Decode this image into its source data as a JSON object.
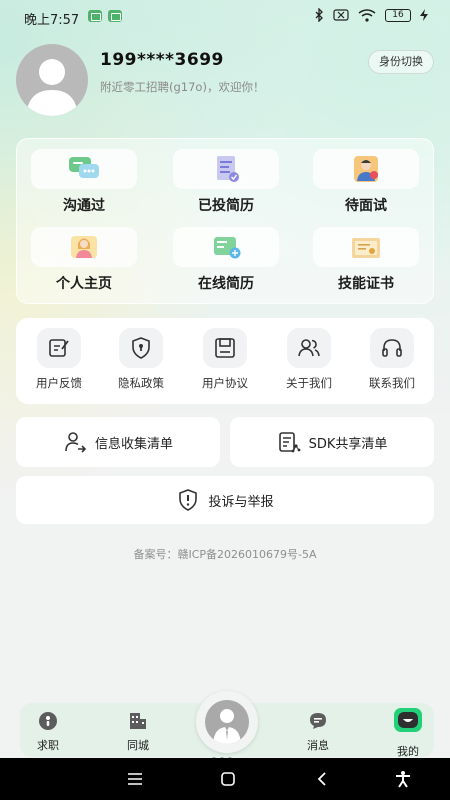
{
  "status_bar": {
    "time": "晚上7:57",
    "battery": "16"
  },
  "profile": {
    "phone": "199****3699",
    "welcome": "附近零工招聘(g17o)，欢迎你！",
    "switch_label": "身份切换"
  },
  "grid": {
    "items": [
      {
        "label": "沟通过",
        "icon": "chat-bubbles-icon"
      },
      {
        "label": "已投简历",
        "icon": "resume-sent-icon"
      },
      {
        "label": "待面试",
        "icon": "interviewer-icon"
      },
      {
        "label": "个人主页",
        "icon": "person-homepage-icon"
      },
      {
        "label": "在线简历",
        "icon": "online-resume-icon"
      },
      {
        "label": "技能证书",
        "icon": "certificate-icon"
      }
    ]
  },
  "links": {
    "items": [
      {
        "label": "用户反馈",
        "icon": "feedback-edit-icon"
      },
      {
        "label": "隐私政策",
        "icon": "shield-keyhole-icon"
      },
      {
        "label": "用户协议",
        "icon": "save-disk-icon"
      },
      {
        "label": "关于我们",
        "icon": "users-group-icon"
      },
      {
        "label": "联系我们",
        "icon": "headset-icon"
      }
    ]
  },
  "actions": {
    "info_list": "信息收集清单",
    "sdk_list": "SDK共享清单",
    "report": "投诉与举报"
  },
  "icp": "备案号：赣ICP备2026010679号-5A",
  "tabbar": {
    "items": [
      {
        "label": "求职",
        "icon": "job-icon"
      },
      {
        "label": "同城",
        "icon": "building-icon"
      },
      {
        "label": "消息",
        "icon": "message-icon"
      },
      {
        "label": "我的",
        "icon": "me-icon",
        "active": true
      }
    ]
  },
  "colors": {
    "accent_green": "#4fb26b",
    "tab_active": "#23b46a",
    "text_gray": "#8a8a8a"
  }
}
